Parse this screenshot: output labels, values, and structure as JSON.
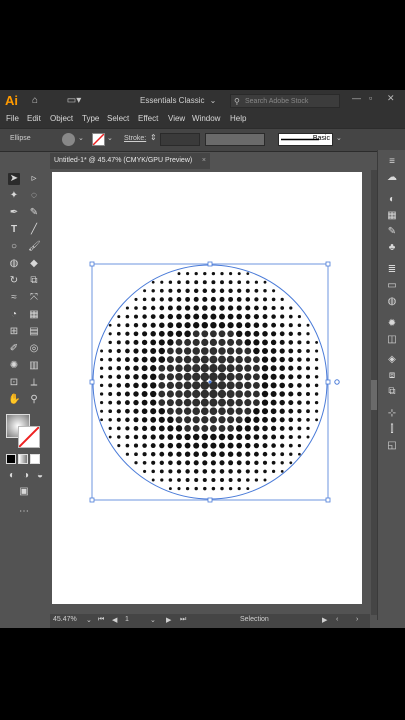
{
  "app": {
    "logo": "Ai",
    "workspace": "Essentials Classic",
    "search_placeholder": "Search Adobe Stock"
  },
  "menu": [
    "File",
    "Edit",
    "Object",
    "Type",
    "Select",
    "Effect",
    "View",
    "Window",
    "Help"
  ],
  "control": {
    "object_type": "Ellipse",
    "stroke_label": "Stroke:",
    "brush": "Basic"
  },
  "document": {
    "tab_title": "Untitled-1* @ 45.47% (CMYK/GPU Preview)",
    "close": "×"
  },
  "status": {
    "zoom": "45.47%",
    "page": "1",
    "tool": "Selection"
  },
  "colors": {
    "accent": "#4a7bd8",
    "logo": "#ff9a00",
    "chrome_dark": "#323232",
    "chrome_mid": "#535353"
  },
  "icons": [
    "home-icon",
    "layout-icon",
    "search-icon",
    "minimize-icon",
    "maximize-icon",
    "close-icon"
  ]
}
